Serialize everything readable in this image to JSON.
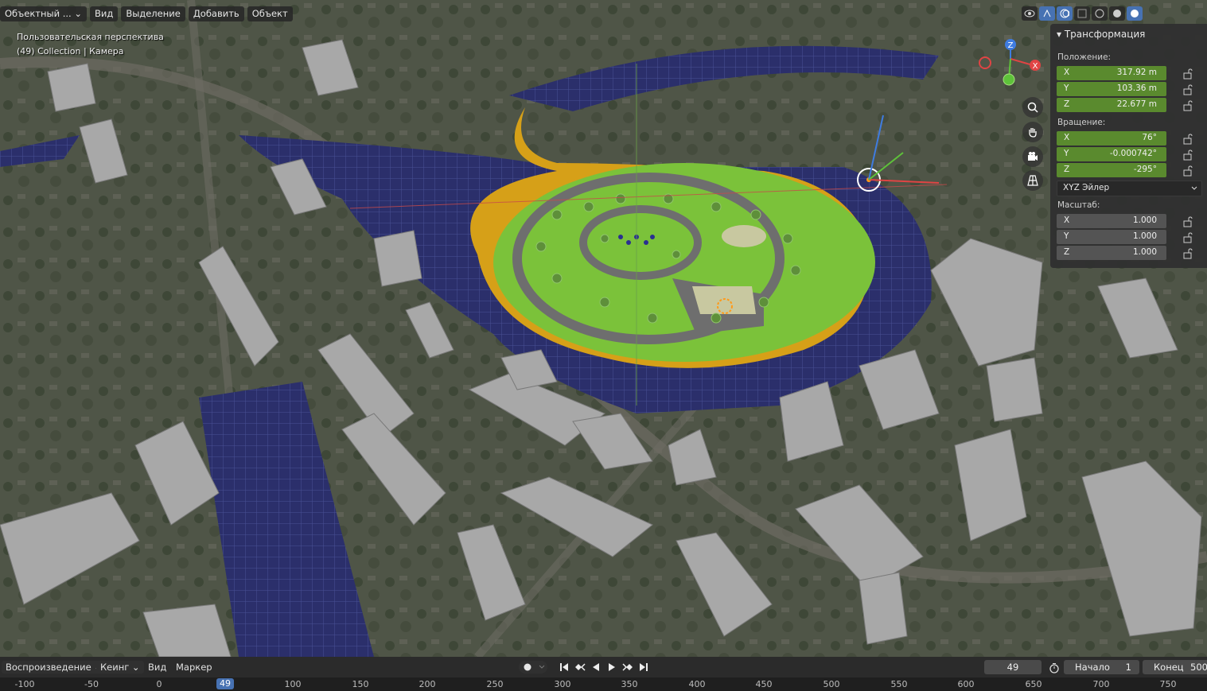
{
  "header": {
    "mode_label": "Объектный ...",
    "menu": [
      "Вид",
      "Выделение",
      "Добавить",
      "Объект"
    ]
  },
  "viewport": {
    "perspective_label": "Пользовательская перспектива",
    "collection_label": "(49) Collection | Камера",
    "gizmo": {
      "x_label": "X",
      "z_label": "Z"
    }
  },
  "transform_panel": {
    "title": "Трансформация",
    "location_label": "Положение:",
    "location": [
      {
        "axis": "X",
        "value": "317.92 m"
      },
      {
        "axis": "Y",
        "value": "103.36 m"
      },
      {
        "axis": "Z",
        "value": "22.677 m"
      }
    ],
    "rotation_label": "Вращение:",
    "rotation": [
      {
        "axis": "X",
        "value": "76°"
      },
      {
        "axis": "Y",
        "value": "-0.000742°"
      },
      {
        "axis": "Z",
        "value": "-295°"
      }
    ],
    "rotation_mode": "XYZ Эйлер",
    "scale_label": "Масштаб:",
    "scale": [
      {
        "axis": "X",
        "value": "1.000"
      },
      {
        "axis": "Y",
        "value": "1.000"
      },
      {
        "axis": "Z",
        "value": "1.000"
      }
    ]
  },
  "timeline": {
    "playback_label": "Воспроизведение",
    "keying_label": "Кеинг",
    "view_label": "Вид",
    "marker_label": "Маркер",
    "current_frame": "49",
    "start_label": "Начало",
    "start_value": "1",
    "end_label": "Конец",
    "end_value": "500",
    "ruler_ticks": [
      "-100",
      "-50",
      "0",
      "50",
      "100",
      "150",
      "200",
      "250",
      "300",
      "350",
      "400",
      "450",
      "500",
      "550",
      "600",
      "650",
      "700",
      "750"
    ]
  },
  "colors": {
    "accent": "#4772b3",
    "field_green": "#5a8a2e",
    "grass": "#7bc23a",
    "orange": "#d6a018",
    "water_plane": "#2b2f6b"
  }
}
